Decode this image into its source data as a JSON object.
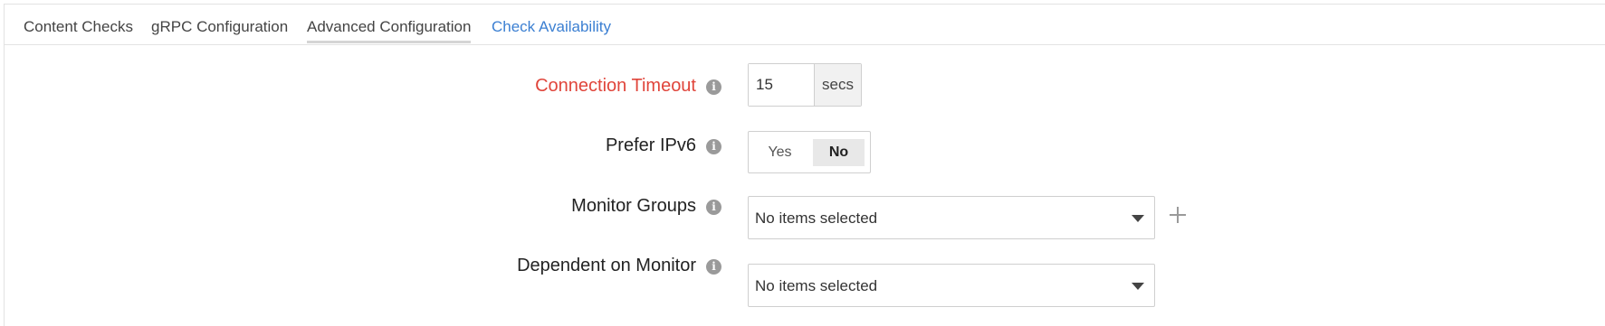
{
  "tabs": [
    {
      "label": "Content Checks"
    },
    {
      "label": "gRPC Configuration"
    },
    {
      "label": "Advanced Configuration"
    },
    {
      "label": "Check Availability"
    }
  ],
  "connection_timeout": {
    "label": "Connection Timeout",
    "value": "15",
    "unit": "secs",
    "info_icon": "info-icon"
  },
  "prefer_ipv6": {
    "label": "Prefer IPv6",
    "option_yes": "Yes",
    "option_no": "No",
    "selected": "No"
  },
  "monitor_groups": {
    "label": "Monitor Groups",
    "value": "No items selected"
  },
  "dependent_on_monitor": {
    "label": "Dependent on Monitor",
    "value": "No items selected"
  },
  "colors": {
    "required_label": "#e0453b",
    "link_tab": "#3b7fd2"
  }
}
